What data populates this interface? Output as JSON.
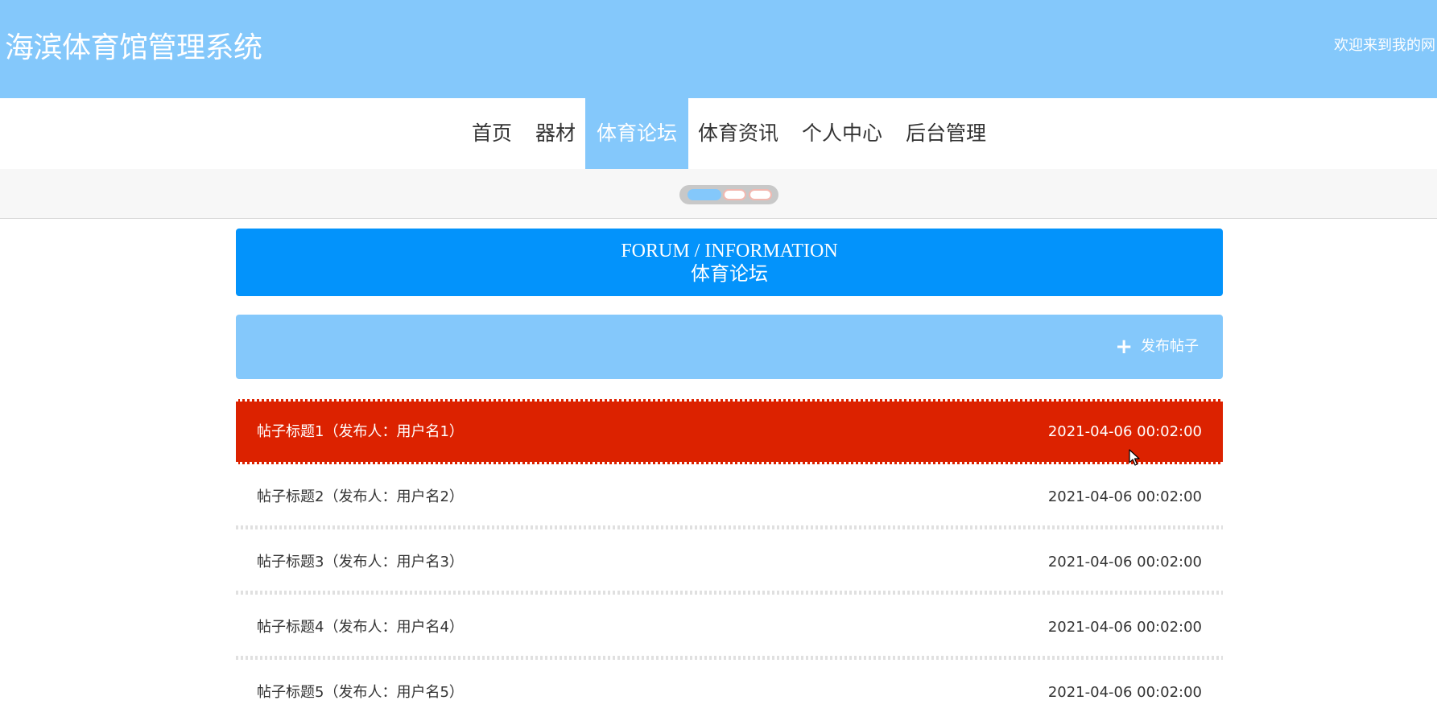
{
  "header": {
    "site_title": "海滨体育馆管理系统",
    "welcome": "欢迎来到我的网"
  },
  "nav": {
    "items": [
      {
        "label": "首页"
      },
      {
        "label": "器材"
      },
      {
        "label": "体育论坛"
      },
      {
        "label": "体育资讯"
      },
      {
        "label": "个人中心"
      },
      {
        "label": "后台管理"
      }
    ],
    "active_index": 2
  },
  "carousel": {
    "slides": 3,
    "active_index": 0
  },
  "forum": {
    "heading_en": "FORUM / INFORMATION",
    "heading_cn": "体育论坛",
    "add_post_label": "发布帖子",
    "add_icon": "plus-icon"
  },
  "posts": [
    {
      "title": "帖子标题1（发布人：用户名1）",
      "time": "2021-04-06 00:02:00"
    },
    {
      "title": "帖子标题2（发布人：用户名2）",
      "time": "2021-04-06 00:02:00"
    },
    {
      "title": "帖子标题3（发布人：用户名3）",
      "time": "2021-04-06 00:02:00"
    },
    {
      "title": "帖子标题4（发布人：用户名4）",
      "time": "2021-04-06 00:02:00"
    },
    {
      "title": "帖子标题5（发布人：用户名5）",
      "time": "2021-04-06 00:02:00"
    }
  ],
  "colors": {
    "header_bg": "#84c8fb",
    "forum_head_bg": "#0393fb",
    "hover_row_bg": "#dc2200"
  }
}
